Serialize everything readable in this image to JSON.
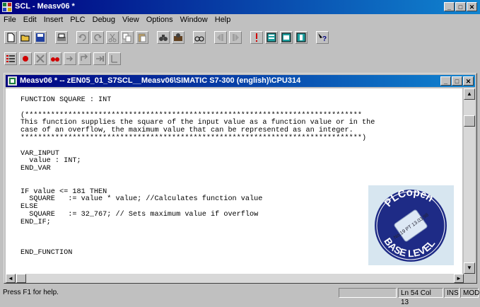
{
  "app": {
    "title": "SCL - Measv06 *"
  },
  "menu": [
    "File",
    "Edit",
    "Insert",
    "PLC",
    "Debug",
    "View",
    "Options",
    "Window",
    "Help"
  ],
  "toolbar1": [
    "new-icon",
    "open-icon",
    "save-icon",
    "print-icon",
    "undo-icon",
    "redo-icon",
    "cut-icon",
    "copy-icon",
    "paste-icon",
    "find-icon",
    "find-replace-icon",
    "goto-icon",
    "bookmark-prev-icon",
    "bookmark-next-icon",
    "compile-icon",
    "block-icon",
    "view-icon",
    "monitor-icon",
    "help-context-icon"
  ],
  "toolbar2": [
    "list-icon",
    "record-icon",
    "breakpoint-icon",
    "glasses-icon",
    "step-icon",
    "step-over-icon",
    "step-out-icon",
    "run-to-cursor-icon"
  ],
  "editor_window": {
    "title": "Measv06 * -- zEN05_01_S7SCL__Measv06\\SIMATIC S7-300 (english)\\CPU314"
  },
  "code": "FUNCTION SQUARE : INT\n\n(******************************************************************************\nThis function supplies the square of the input value as a function value or in the\ncase of an overflow, the maximum value that can be represented as an integer.\n*******************************************************************************)\n\nVAR_INPUT\n  value : INT;\nEND_VAR\n\n\nIF value <= 181 THEN\n  SQUARE   := value * value; //Calculates function value\nELSE\n  SQUARE   := 32_767; // Sets maximum value if overflow\nEND_IF;\n\n\n\nEND_FUNCTION",
  "badge": {
    "top": "PLCopen",
    "bottom": "BASE LEVEL",
    "stamp": "No.19 PT 13.03.98"
  },
  "status": {
    "help": "Press F1 for help.",
    "position": "Ln 54 Col 13",
    "ins": "INS",
    "mod": "MOD"
  }
}
